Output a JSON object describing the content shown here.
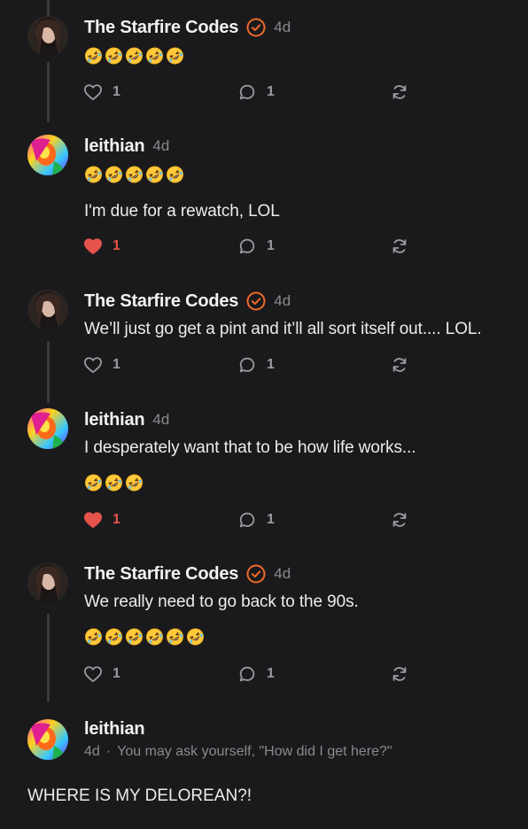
{
  "colors": {
    "background": "#1a1a1c",
    "like_active": "#e5534b",
    "verified": "#f06a2a",
    "muted": "#8a8a8e"
  },
  "posts": [
    {
      "author": "The Starfire Codes",
      "verified": true,
      "time": "4d",
      "avatar": "starfire-avatar",
      "emoji_count": 5,
      "text": "",
      "likes": "1",
      "liked": false,
      "replies": "1"
    },
    {
      "author": "leithian",
      "verified": false,
      "time": "4d",
      "avatar": "leithian-avatar",
      "emoji_count": 5,
      "text": "I'm due for a rewatch, LOL",
      "likes": "1",
      "liked": true,
      "replies": "1"
    },
    {
      "author": "The Starfire Codes",
      "verified": true,
      "time": "4d",
      "avatar": "starfire-avatar",
      "text": "We’ll just go get a pint and it’ll all sort itself out.... LOL.",
      "likes": "1",
      "liked": false,
      "replies": "1"
    },
    {
      "author": "leithian",
      "verified": false,
      "time": "4d",
      "avatar": "leithian-avatar",
      "text": "I desperately want that to be how life works...",
      "emoji_count": 3,
      "likes": "1",
      "liked": true,
      "replies": "1"
    },
    {
      "author": "The Starfire Codes",
      "verified": true,
      "time": "4d",
      "avatar": "starfire-avatar",
      "text": "We really need to go back to the 90s.",
      "emoji_count": 6,
      "likes": "1",
      "liked": false,
      "replies": "1"
    }
  ],
  "reply_context": {
    "author": "leithian",
    "time": "4d",
    "separator": "·",
    "reply_preview": "You may ask yourself, \"How did I get here?\"",
    "body": "WHERE IS MY DELOREAN?!"
  },
  "icons": {
    "like": "heart-icon",
    "reply": "speech-bubble-icon",
    "repost": "repost-arrows-icon",
    "verified": "verified-check-icon",
    "emoji": "rolling-on-floor-laughing-emoji"
  }
}
